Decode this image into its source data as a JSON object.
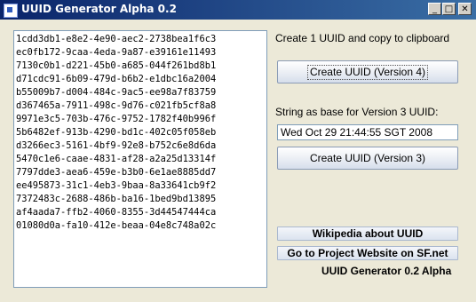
{
  "window": {
    "title": "UUID Generator Alpha 0.2",
    "buttons": {
      "minimize": "_",
      "maximize": "□",
      "close": "✕"
    }
  },
  "uuid_list": [
    "1cdd3db1-e8e2-4e90-aec2-2738bea1f6c3",
    "ec0fb172-9caa-4eda-9a87-e39161e11493",
    "7130c0b1-d221-45b0-a685-044f261bd8b1",
    "d71cdc91-6b09-479d-b6b2-e1dbc16a2004",
    "b55009b7-d004-484c-9ac5-ee98a7f83759",
    "d367465a-7911-498c-9d76-c021fb5cf8a8",
    "9971e3c5-703b-476c-9752-1782f40b996f",
    "5b6482ef-913b-4290-bd1c-402c05f058eb",
    "d3266ec3-5161-4bf9-92e8-b752c6e8d6da",
    "5470c1e6-caae-4831-af28-a2a25d13314f",
    "7797dde3-aea6-459e-b3b0-6e1ae8885dd7",
    "ee495873-31c1-4eb3-9baa-8a33641cb9f2",
    "7372483c-2688-486b-ba16-1bed9bd13895",
    "af4aada7-ffb2-4060-8355-3d44547444ca",
    "01080d0a-fa10-412e-beaa-04e8c748a02c"
  ],
  "panel": {
    "create_label": "Create 1 UUID and copy to clipboard",
    "v4_button": "Create UUID (Version 4)",
    "v3_label": "String as base for Version 3 UUID:",
    "v3_input_value": "Wed Oct 29 21:44:55 SGT 2008",
    "v3_button": "Create UUID (Version 3)",
    "wiki_link": "Wikipedia about UUID",
    "project_link": "Go to Project Website on SF.net",
    "version_label": "UUID Generator 0.2 Alpha"
  }
}
